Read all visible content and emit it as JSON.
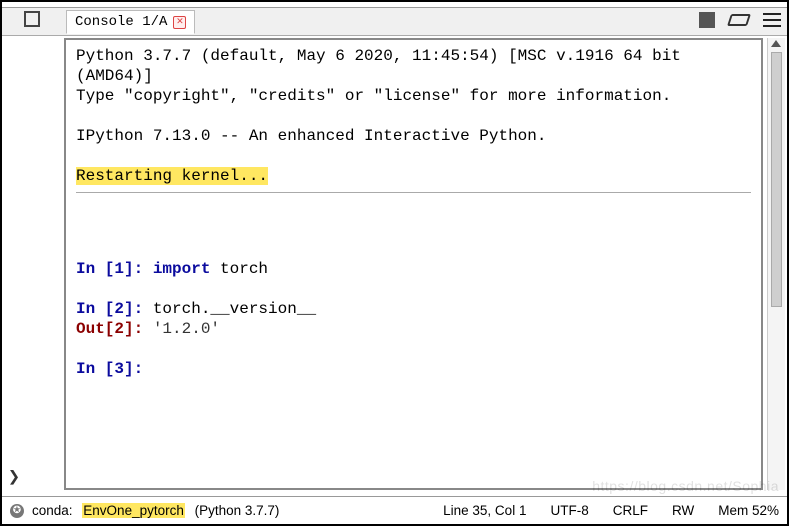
{
  "tab": {
    "label": "Console 1/A"
  },
  "console": {
    "banner_line1": "Python 3.7.7 (default, May  6 2020, 11:45:54) [MSC v.1916 64 bit (AMD64)]",
    "banner_line2": "Type \"copyright\", \"credits\" or \"license\" for more information.",
    "ipython_line": "IPython 7.13.0 -- An enhanced Interactive Python.",
    "restart_hl": "Restarting kernel...",
    "in1_prompt": "In [1]: ",
    "in1_kw": "import",
    "in1_rest": " torch",
    "in2_prompt": "In [2]: ",
    "in2_code": "torch.__version__",
    "out2_prompt": "Out[2]: ",
    "out2_value": "'1.2.0'",
    "in3_prompt": "In [3]: "
  },
  "status": {
    "conda_label": "conda: ",
    "env": "EnvOne_pytorch",
    "python": " (Python 3.7.7)",
    "line_col": "Line 35, Col 1",
    "encoding": "UTF-8",
    "eol": "CRLF",
    "mode": "RW",
    "mem": "Mem 52%"
  },
  "bottom_left_glyph": "❯",
  "watermark": "https://blog.csdn.net/Sophia"
}
